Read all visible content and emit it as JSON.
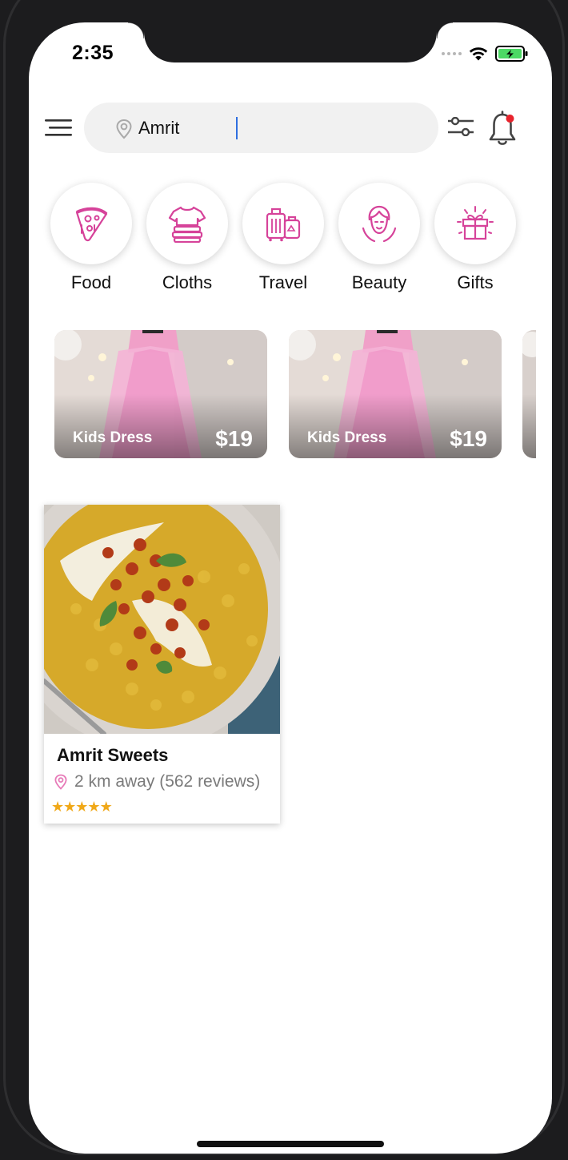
{
  "status_bar": {
    "time": "2:35"
  },
  "search": {
    "value": "Amrit"
  },
  "categories": [
    {
      "label": "Food",
      "icon": "pizza-icon"
    },
    {
      "label": "Cloths",
      "icon": "clothes-icon"
    },
    {
      "label": "Travel",
      "icon": "luggage-icon"
    },
    {
      "label": "Beauty",
      "icon": "beauty-face-icon"
    },
    {
      "label": "Gifts",
      "icon": "gift-icon"
    }
  ],
  "promos": [
    {
      "title": "Kids Dress",
      "price": "$19"
    },
    {
      "title": "Kids Dress",
      "price": "$19"
    }
  ],
  "result": {
    "name": "Amrit Sweets",
    "distance": "2 km away (562 reviews)",
    "rating": 5
  },
  "colors": {
    "accent": "#d6439a",
    "star": "#f0a818",
    "notification_dot": "#e8232c",
    "cursor": "#2f6fe0"
  }
}
